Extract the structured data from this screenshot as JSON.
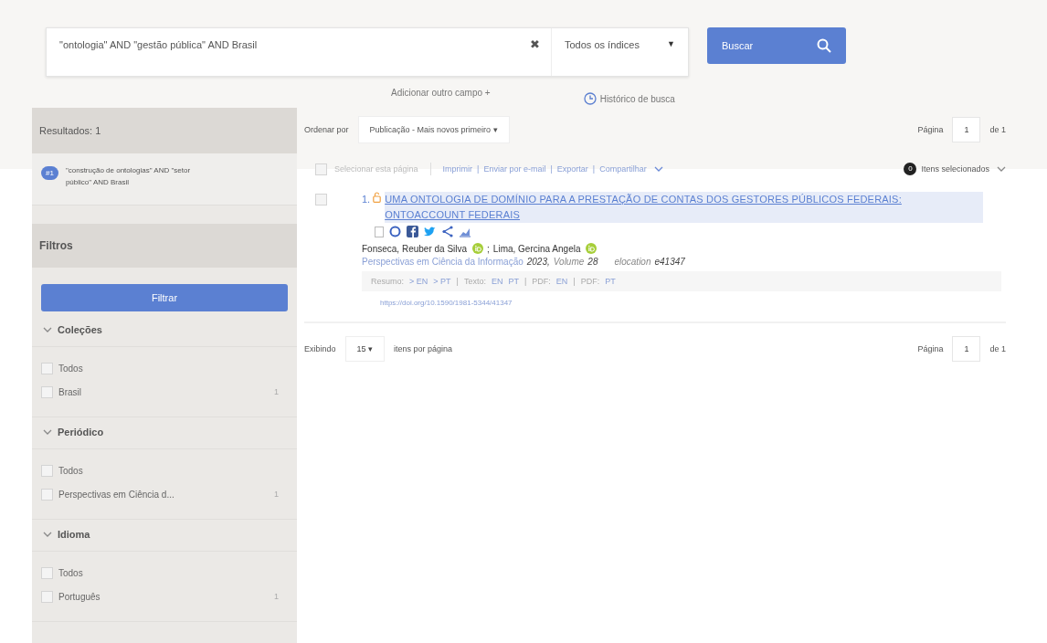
{
  "search": {
    "query": "\"ontologia\" AND \"gestão pública\" AND Brasil",
    "clear": "✖",
    "index": "Todos os índices",
    "index_caret": "▼",
    "button": "Buscar",
    "add_field": "Adicionar outro campo +",
    "history": "Histórico de busca"
  },
  "sidebar": {
    "results_label": "Resultados: 1",
    "history_item": {
      "badge": "#1",
      "text": "\"construção de ontologias\" AND \"setor público\" AND Brasil"
    },
    "filters_title": "Filtros",
    "filter_button": "Filtrar",
    "groups": [
      {
        "title": "Coleções",
        "expanded": true,
        "options": [
          {
            "label": "Todos",
            "checked": false
          },
          {
            "label": "Brasil",
            "checked": false,
            "count": "1"
          }
        ]
      },
      {
        "title": "Periódico",
        "expanded": true,
        "options": [
          {
            "label": "Todos",
            "checked": false
          },
          {
            "label": "Perspectivas em Ciência d...",
            "checked": false,
            "count": "1"
          }
        ]
      },
      {
        "title": "Idioma",
        "expanded": true,
        "options": [
          {
            "label": "Todos",
            "checked": false
          },
          {
            "label": "Português",
            "checked": false,
            "count": "1"
          }
        ]
      }
    ]
  },
  "toolbar": {
    "sort_label": "Ordenar por",
    "sort_value": "Publicação - Mais novos primeiro ▾",
    "page_label": "Página",
    "page": "1",
    "page_of": "de 1"
  },
  "actions": {
    "select_page": "Selecionar esta página",
    "select_checked": false,
    "links": [
      "Imprimir",
      "Enviar por e-mail",
      "Exportar",
      "Compartilhar"
    ],
    "separator": "|",
    "selected_count": "0",
    "selected_label": "Itens selecionados"
  },
  "results": [
    {
      "checked": false,
      "number": "1.",
      "title": "UMA ONTOLOGIA DE DOMÍNIO PARA A PRESTAÇÃO DE CONTAS DOS GESTORES PÚBLICOS FEDERAIS: ONTOACCOUNT FEDERAIS",
      "authors": [
        "Fonseca, Reuber da Silva",
        "Lima, Gercina Angela"
      ],
      "author_separator": ";",
      "journal": "Perspectivas em Ciência da Informação",
      "year": "2023,",
      "volume_label": "Volume",
      "volume": "28",
      "elocation_label": "elocation",
      "elocation": "e41347",
      "links": [
        {
          "kind": "label",
          "text": "Resumo:"
        },
        {
          "kind": "link",
          "text": "> EN"
        },
        {
          "kind": "link",
          "text": "> PT"
        },
        {
          "kind": "sep",
          "text": "|"
        },
        {
          "kind": "label",
          "text": "Texto:"
        },
        {
          "kind": "link",
          "text": "EN"
        },
        {
          "kind": "link",
          "text": "PT"
        },
        {
          "kind": "sep",
          "text": "|"
        },
        {
          "kind": "label",
          "text": "PDF:"
        },
        {
          "kind": "link",
          "text": "EN"
        },
        {
          "kind": "sep",
          "text": "|"
        },
        {
          "kind": "label",
          "text": "PDF:"
        },
        {
          "kind": "link",
          "text": "PT"
        }
      ],
      "doi": "https://doi.org/10.1590/1981-5344/41347"
    }
  ],
  "footer": {
    "show_label": "Exibindo",
    "per_page": "15 ▾",
    "per_page_label": "itens por página",
    "page_label": "Página",
    "page": "1",
    "page_of": "de 1"
  }
}
